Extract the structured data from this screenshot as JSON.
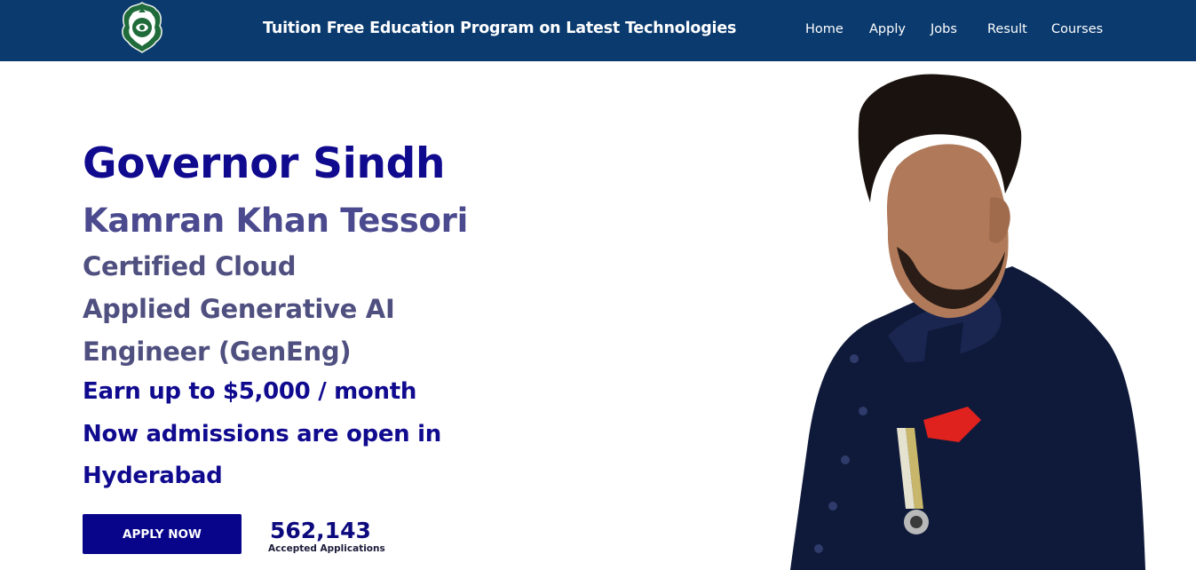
{
  "header": {
    "site_title": "Tuition Free Education Program on Latest Technologies",
    "nav": [
      "Home",
      "Apply",
      "Jobs",
      "Result",
      "Courses"
    ],
    "logo_icon": "emblem-logo-icon"
  },
  "hero": {
    "title": "Governor Sindh",
    "name": "Kamran Khan Tessori",
    "program_lines": [
      "Certified Cloud",
      "Applied Generative AI",
      "Engineer (GenEng)"
    ],
    "earnings": "Earn up to $5,000 / month",
    "admissions_line": "Now admissions are open in",
    "city": "Hyderabad",
    "apply_button": "APPLY NOW",
    "stat_value": "562,143",
    "stat_label": "Accepted Applications"
  },
  "colors": {
    "header_bg": "#0a3a6e",
    "primary": "#100a8f",
    "secondary": "#4b4a8f",
    "button_bg": "#08058a"
  }
}
